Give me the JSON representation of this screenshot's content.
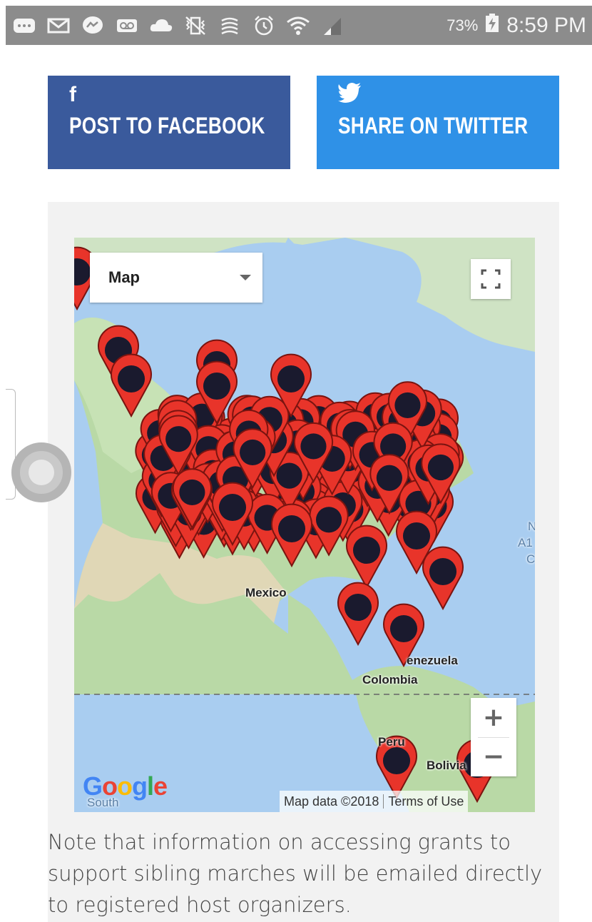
{
  "status_bar": {
    "icons": [
      "chat-bubble-icon",
      "mail-icon",
      "messenger-icon",
      "voicemail-icon",
      "cloud-icon",
      "vibrate-mute-icon",
      "nfc-icon",
      "alarm-icon",
      "wifi-icon",
      "signal-icon"
    ],
    "battery": "73%",
    "time": "8:59 PM"
  },
  "share": {
    "facebook": {
      "glyph": "f",
      "label": "POST TO FACEBOOK",
      "color": "#3a5a9c"
    },
    "twitter": {
      "glyph": "bird",
      "label": "SHARE ON TWITTER",
      "color": "#2f91e7"
    }
  },
  "map": {
    "type_selector": "Map",
    "labels": {
      "mexico": "Mexico",
      "venezuela": "enezuela",
      "colombia": "Colombia",
      "peru": "Peru",
      "bolivia": "Bolivia",
      "atlantic_1": "N",
      "atlantic_2": "A1",
      "atlantic_3": "C",
      "south": "South"
    },
    "zoom_in": "+",
    "zoom_out": "−",
    "attribution": {
      "data": "Map data ©2018",
      "terms": "Terms of Use"
    },
    "google": "Google",
    "marker_color": "#e8342a",
    "marker_dot_color": "#1a1a2e"
  },
  "note": "Note that information on accessing grants to support sibling marches will be emailed directly to registered host organizers."
}
